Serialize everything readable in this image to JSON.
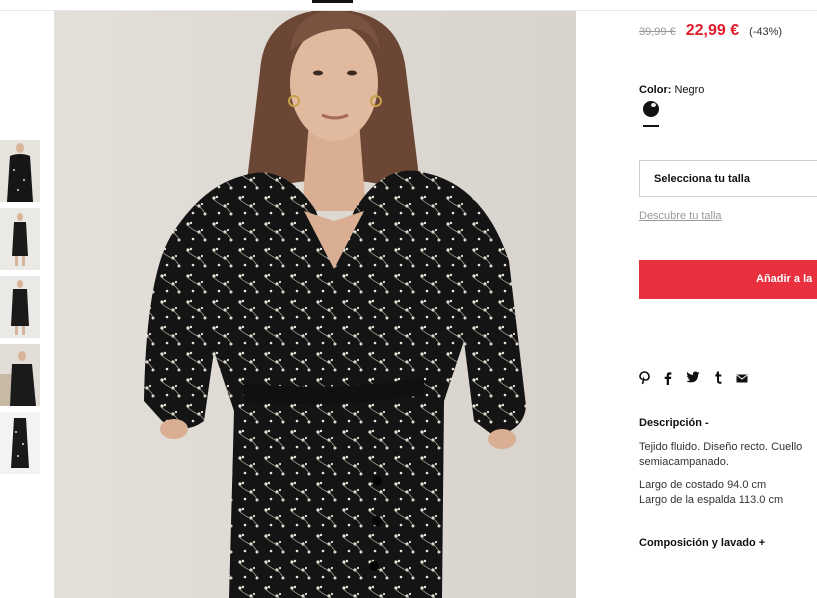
{
  "product": {
    "old_price": "39,99 €",
    "new_price": "22,99 €",
    "discount": "(-43%)",
    "color_label": "Color:",
    "color_value": "Negro",
    "size_placeholder": "Selecciona tu talla",
    "size_guide_link": "Descubre tu talla",
    "add_to_cart": "Añadir a la",
    "description_title": "Descripción -",
    "description_text": "Tejido fluido. Diseño recto. Cuello semiacampanado.",
    "measure_side": "Largo de costado 94.0 cm",
    "measure_back": "Largo de la espalda 113.0 cm",
    "composition_title": "Composición y lavado +"
  },
  "share_icons": [
    "pinterest-icon",
    "facebook-icon",
    "twitter-icon",
    "tumblr-icon",
    "email-icon"
  ],
  "share_glyphs": [
    "𝓅",
    "f",
    "🐦",
    "t",
    "✉"
  ],
  "colors": {
    "price_red": "#e11c2b",
    "button_red": "#e8303e",
    "dress": "#151515",
    "background": "#e4e1dc"
  }
}
